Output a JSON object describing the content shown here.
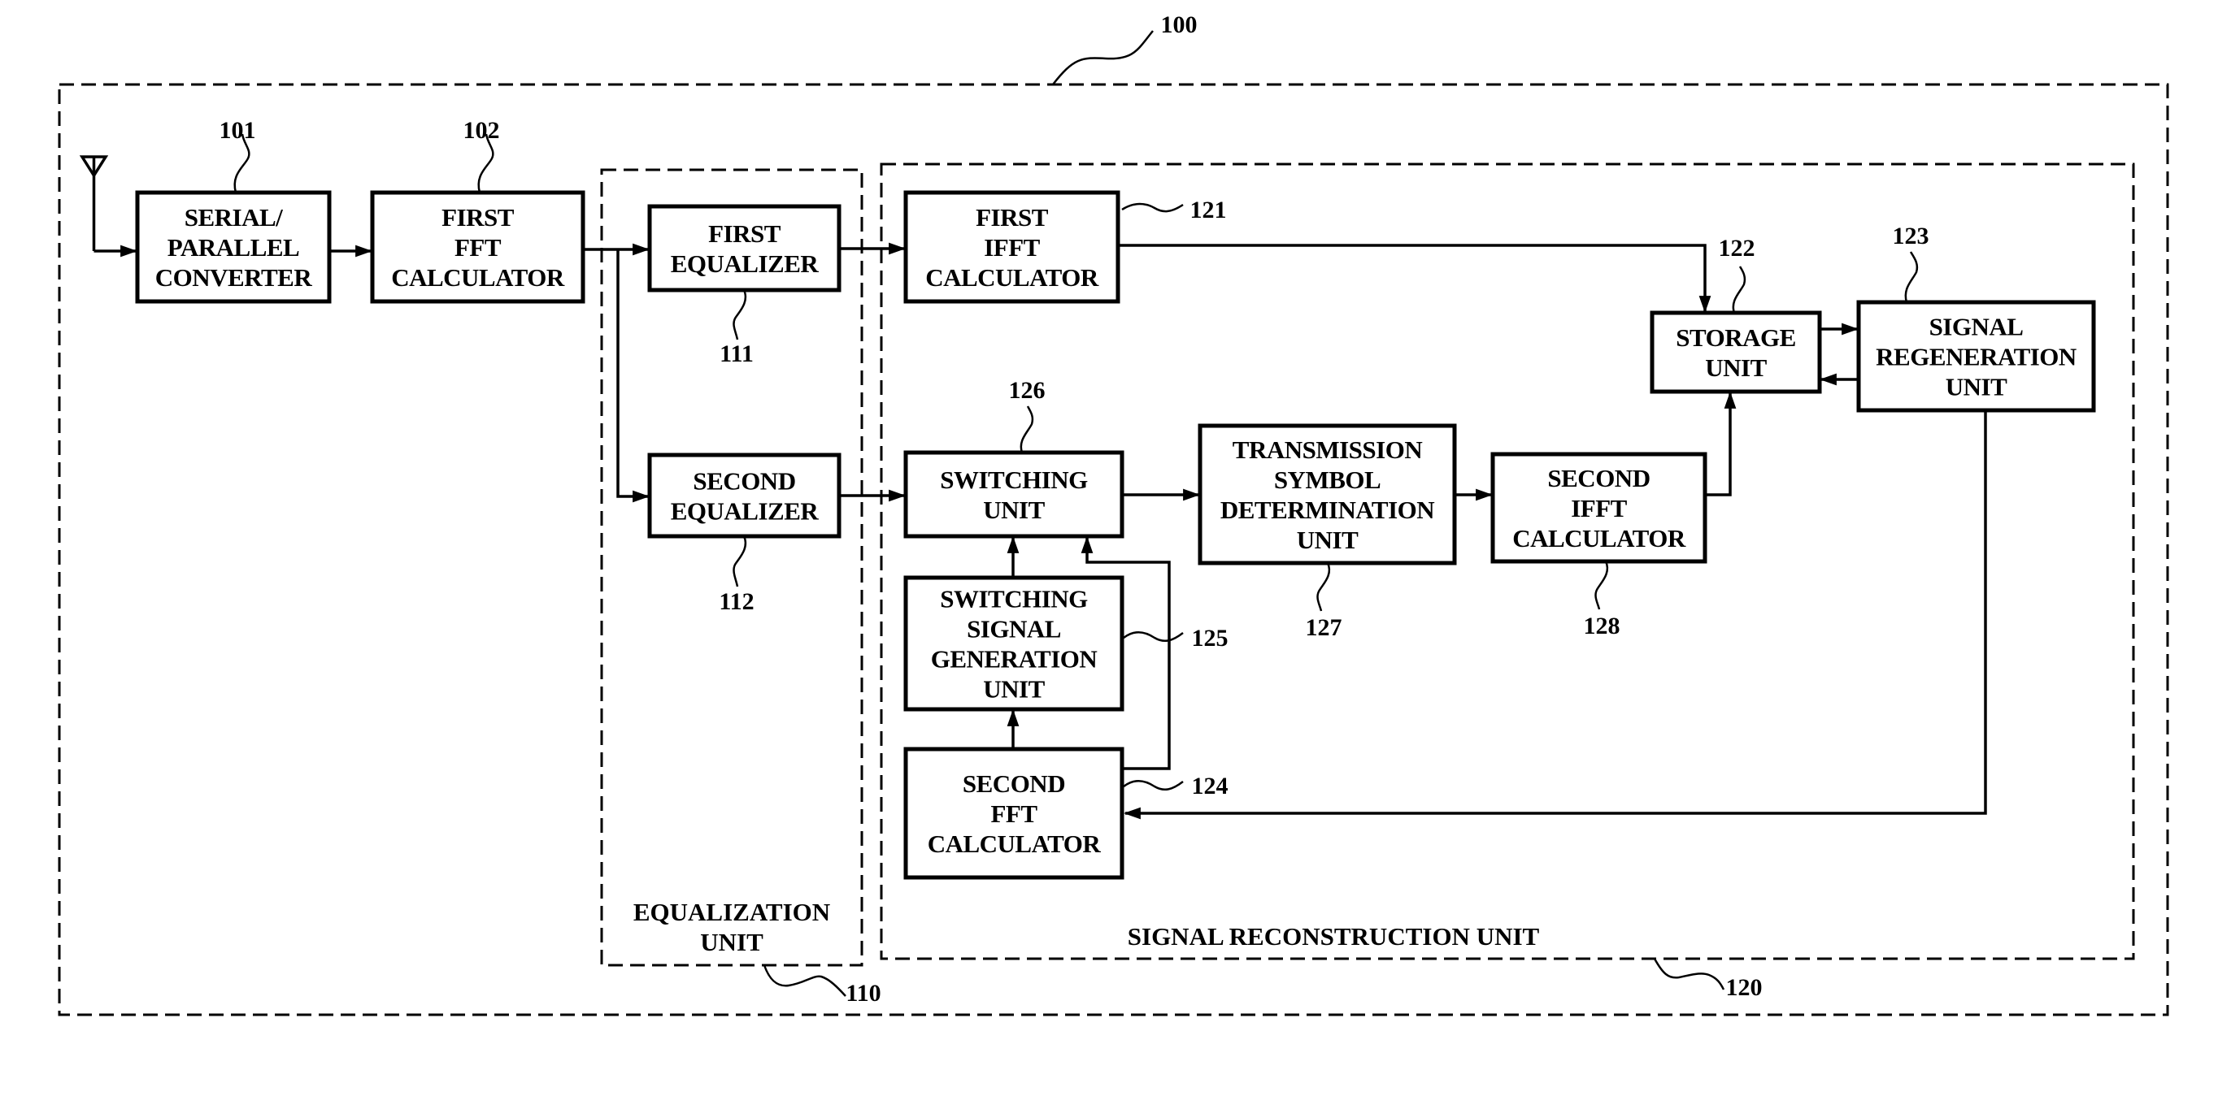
{
  "figure": {
    "type": "block-diagram",
    "reference": "100"
  },
  "groups": [
    {
      "id": "outer",
      "ref": "100",
      "label": ""
    },
    {
      "id": "equalization",
      "ref": "110",
      "label_lines": [
        "EQUALIZATION",
        "UNIT"
      ]
    },
    {
      "id": "reconstruction",
      "ref": "120",
      "label_lines": [
        "SIGNAL RECONSTRUCTION UNIT"
      ]
    }
  ],
  "blocks": [
    {
      "id": "serial-parallel-converter",
      "ref": "101",
      "lines": [
        "SERIAL/",
        "PARALLEL",
        "CONVERTER"
      ]
    },
    {
      "id": "first-fft-calculator",
      "ref": "102",
      "lines": [
        "FIRST",
        "FFT",
        "CALCULATOR"
      ]
    },
    {
      "id": "first-equalizer",
      "ref": "111",
      "lines": [
        "FIRST",
        "EQUALIZER"
      ]
    },
    {
      "id": "second-equalizer",
      "ref": "112",
      "lines": [
        "SECOND",
        "EQUALIZER"
      ]
    },
    {
      "id": "first-ifft-calculator",
      "ref": "121",
      "lines": [
        "FIRST",
        "IFFT",
        "CALCULATOR"
      ]
    },
    {
      "id": "storage-unit",
      "ref": "122",
      "lines": [
        "STORAGE",
        "UNIT"
      ]
    },
    {
      "id": "signal-regeneration-unit",
      "ref": "123",
      "lines": [
        "SIGNAL",
        "REGENERATION",
        "UNIT"
      ]
    },
    {
      "id": "second-fft-calculator",
      "ref": "124",
      "lines": [
        "SECOND",
        "FFT",
        "CALCULATOR"
      ]
    },
    {
      "id": "switching-signal-generation-unit",
      "ref": "125",
      "lines": [
        "SWITCHING",
        "SIGNAL",
        "GENERATION",
        "UNIT"
      ]
    },
    {
      "id": "switching-unit",
      "ref": "126",
      "lines": [
        "SWITCHING",
        "UNIT"
      ]
    },
    {
      "id": "transmission-symbol-determination-unit",
      "ref": "127",
      "lines": [
        "TRANSMISSION",
        "SYMBOL",
        "DETERMINATION",
        "UNIT"
      ]
    },
    {
      "id": "second-ifft-calculator",
      "ref": "128",
      "lines": [
        "SECOND",
        "IFFT",
        "CALCULATOR"
      ]
    }
  ],
  "connections": [
    {
      "from": "antenna",
      "to": "serial-parallel-converter"
    },
    {
      "from": "serial-parallel-converter",
      "to": "first-fft-calculator"
    },
    {
      "from": "first-fft-calculator",
      "to": "first-equalizer"
    },
    {
      "from": "first-fft-calculator",
      "to": "second-equalizer"
    },
    {
      "from": "first-equalizer",
      "to": "first-ifft-calculator"
    },
    {
      "from": "second-equalizer",
      "to": "switching-unit"
    },
    {
      "from": "first-ifft-calculator",
      "to": "storage-unit"
    },
    {
      "from": "storage-unit",
      "to": "signal-regeneration-unit"
    },
    {
      "from": "signal-regeneration-unit",
      "to": "storage-unit"
    },
    {
      "from": "signal-regeneration-unit",
      "to": "second-fft-calculator"
    },
    {
      "from": "second-fft-calculator",
      "to": "switching-signal-generation-unit"
    },
    {
      "from": "second-fft-calculator",
      "to": "switching-unit"
    },
    {
      "from": "switching-signal-generation-unit",
      "to": "switching-unit"
    },
    {
      "from": "switching-unit",
      "to": "transmission-symbol-determination-unit"
    },
    {
      "from": "transmission-symbol-determination-unit",
      "to": "second-ifft-calculator"
    },
    {
      "from": "second-ifft-calculator",
      "to": "storage-unit"
    }
  ],
  "icons": {
    "antenna": "antenna-icon"
  }
}
